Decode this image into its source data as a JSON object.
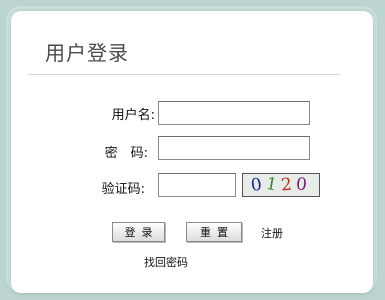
{
  "login": {
    "title": "用户登录",
    "username_label": "用户名:",
    "password_label": "密　码:",
    "captcha_label": "验证码:",
    "username_value": "",
    "password_value": "",
    "captcha_value": "",
    "captcha_chars": [
      "0",
      "1",
      "2",
      "0"
    ],
    "login_button": "登录",
    "reset_button": "重置",
    "register_link": "注册",
    "forgot_link": "找回密码"
  }
}
